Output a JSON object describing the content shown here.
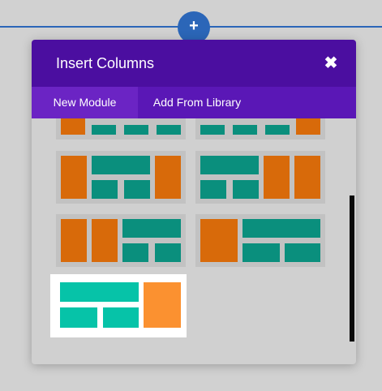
{
  "page": {
    "add_symbol": "+"
  },
  "modal": {
    "title": "Insert Columns",
    "close_symbol": "✖",
    "tabs": [
      {
        "label": "New Module",
        "active": true
      },
      {
        "label": "Add From Library",
        "active": false
      }
    ]
  },
  "colors": {
    "accent_blue": "#2b66b8",
    "header_purple": "#4b0ea0",
    "tab_purple": "#5a17b6",
    "column_orange": "#d86a0a",
    "column_teal": "#0a8f7d",
    "selected_orange": "#fb9130",
    "selected_teal": "#06c3a8"
  },
  "layouts": [
    {
      "name": "layout-option-1",
      "selected": false
    },
    {
      "name": "layout-option-2",
      "selected": false
    },
    {
      "name": "layout-option-3",
      "selected": false
    },
    {
      "name": "layout-option-4",
      "selected": false
    },
    {
      "name": "layout-option-5",
      "selected": false
    },
    {
      "name": "layout-option-6",
      "selected": false
    },
    {
      "name": "layout-option-7",
      "selected": true
    }
  ]
}
